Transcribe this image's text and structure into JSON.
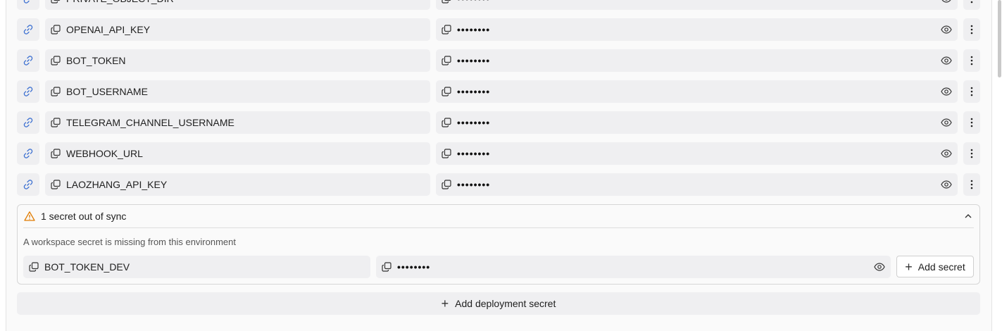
{
  "secrets": [
    {
      "key": "PRIVATE_OBJECT_DIR",
      "value": "••••••••"
    },
    {
      "key": "OPENAI_API_KEY",
      "value": "••••••••"
    },
    {
      "key": "BOT_TOKEN",
      "value": "••••••••"
    },
    {
      "key": "BOT_USERNAME",
      "value": "••••••••"
    },
    {
      "key": "TELEGRAM_CHANNEL_USERNAME",
      "value": "••••••••"
    },
    {
      "key": "WEBHOOK_URL",
      "value": "••••••••"
    },
    {
      "key": "LAOZHANG_API_KEY",
      "value": "••••••••"
    }
  ],
  "sync": {
    "title": "1 secret out of sync",
    "description": "A workspace secret is missing from this environment",
    "missing_key": "BOT_TOKEN_DEV",
    "missing_value": "••••••••",
    "add_label": "Add secret"
  },
  "add_deployment_label": "Add deployment secret",
  "colors": {
    "link": "#3b6fd1",
    "warning": "#e07b00"
  }
}
